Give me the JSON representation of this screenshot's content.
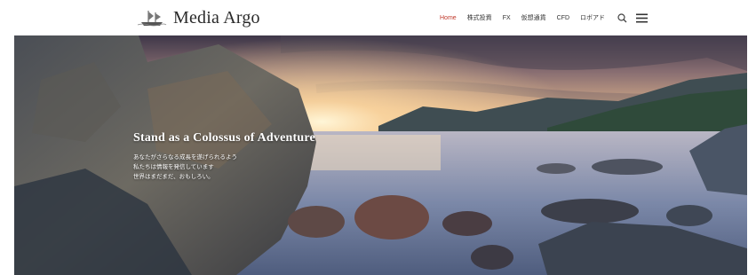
{
  "header": {
    "logo_text": "Media Argo",
    "logo_icon": "sailing-ship-icon"
  },
  "nav": {
    "items": [
      {
        "label": "Home",
        "active": true
      },
      {
        "label": "株式投資",
        "active": false
      },
      {
        "label": "FX",
        "active": false
      },
      {
        "label": "仮想通貨",
        "active": false
      },
      {
        "label": "CFD",
        "active": false
      },
      {
        "label": "ロボアド",
        "active": false
      }
    ],
    "search_icon": "search-icon",
    "menu_icon": "hamburger-menu-icon"
  },
  "hero": {
    "title": "Stand as a Colossus of Adventure",
    "lines": [
      "あなたがさらなる成長を遂げられるよう",
      "私たちは情報を発信しています",
      "世界はまだまだ、おもしろい。"
    ]
  },
  "colors": {
    "nav_active": "#c0392b",
    "nav_text": "#333333",
    "hero_text": "#ffffff"
  }
}
